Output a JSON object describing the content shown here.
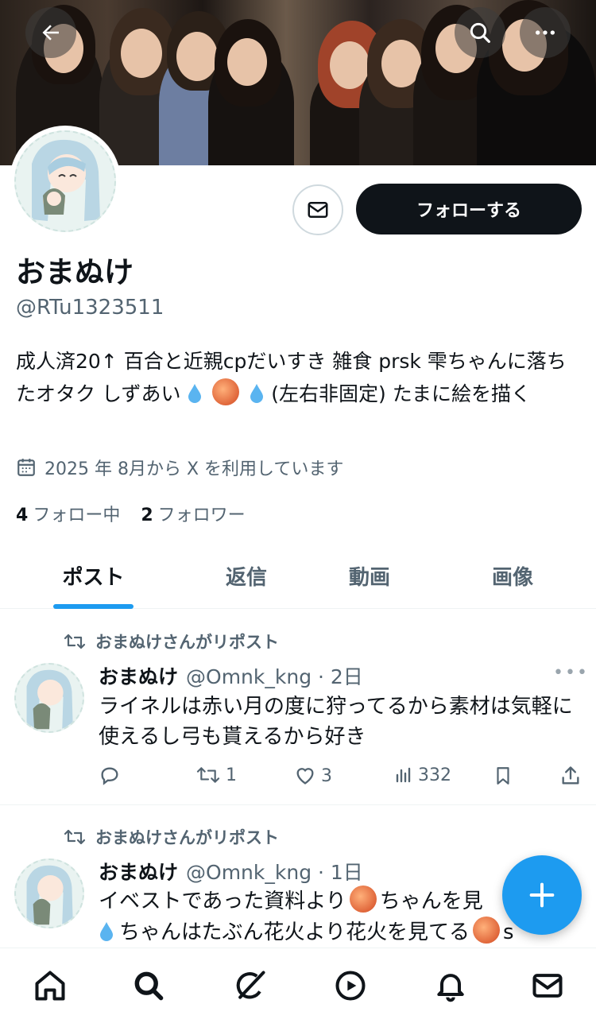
{
  "header": {
    "back_icon": "arrow-left-icon",
    "search_icon": "search-icon",
    "more_icon": "more-horizontal-icon"
  },
  "profile": {
    "display_name": "おまぬけ",
    "handle": "@RTu1323511",
    "bio_part1": "成人済20↑ 百合と近親cpだいすき 雑食 prsk 雫ちゃんに落ちたオタク しずあい",
    "bio_part2": "(左右非固定) たまに絵を描く",
    "joined": "2025 年 8月から X を利用しています",
    "following_count": "4",
    "following_label": "フォロー中",
    "followers_count": "2",
    "followers_label": "フォロワー",
    "follow_button": "フォローする",
    "message_icon": "mail-icon"
  },
  "tabs": [
    {
      "label": "ポスト",
      "active": true
    },
    {
      "label": "返信",
      "active": false
    },
    {
      "label": "動画",
      "active": false
    },
    {
      "label": "画像",
      "active": false
    }
  ],
  "posts": [
    {
      "repost_label": "おまぬけさんがリポスト",
      "name": "おまぬけ",
      "handle_time": "@Omnk_kng · 2日",
      "text": "ライネルは赤い月の度に狩ってるから素材は気軽に使えるし弓も貰えるから好き",
      "reply_count": "",
      "repost_count": "1",
      "like_count": "3",
      "view_count": "332"
    },
    {
      "repost_label": "おまぬけさんがリポスト",
      "name": "おまぬけ",
      "handle_time": "@Omnk_kng · 1日",
      "text_line1": "イベストであった資料より",
      "text_line1b": "ちゃんを見",
      "text_line2": "ちゃんはたぶん花火より花火を見てる",
      "text_line2b": "s"
    }
  ],
  "colors": {
    "accent": "#1d9bf0",
    "text_primary": "#0f1419",
    "text_secondary": "#536471"
  },
  "bottom_nav": [
    "home-icon",
    "search-icon",
    "grok-icon",
    "video-icon",
    "notifications-icon",
    "messages-icon"
  ]
}
